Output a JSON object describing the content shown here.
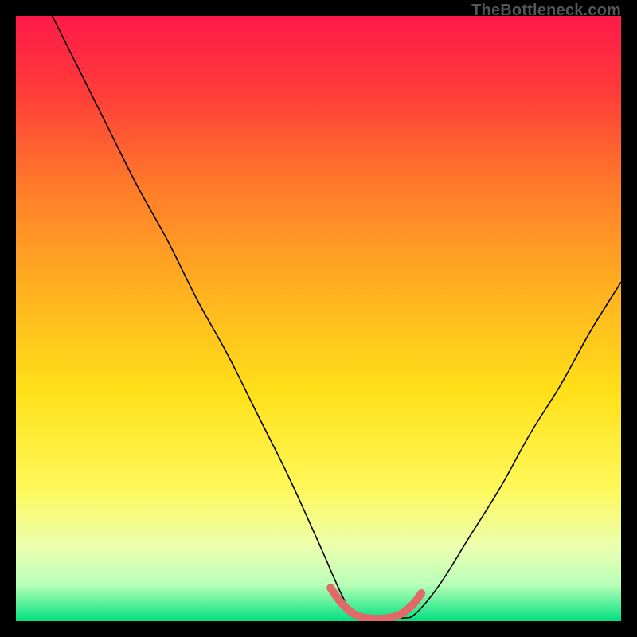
{
  "watermark": "TheBottleneck.com",
  "chart_data": {
    "type": "line",
    "title": "",
    "xlabel": "",
    "ylabel": "",
    "xlim": [
      0,
      100
    ],
    "ylim": [
      0,
      100
    ],
    "grid": false,
    "legend": false,
    "annotations": [],
    "background_gradient": {
      "orientation": "vertical",
      "stops": [
        {
          "pos": 0.0,
          "color": "#ff1a4a"
        },
        {
          "pos": 0.12,
          "color": "#ff3a3a"
        },
        {
          "pos": 0.28,
          "color": "#ff7a2a"
        },
        {
          "pos": 0.45,
          "color": "#ffb020"
        },
        {
          "pos": 0.62,
          "color": "#ffe018"
        },
        {
          "pos": 0.78,
          "color": "#fff85a"
        },
        {
          "pos": 0.88,
          "color": "#eaffb0"
        },
        {
          "pos": 0.94,
          "color": "#b8ffb8"
        },
        {
          "pos": 1.0,
          "color": "#00e080"
        }
      ]
    },
    "series": [
      {
        "name": "bottleneck-curve",
        "color": "#000000",
        "x": [
          6,
          10,
          15,
          20,
          25,
          30,
          35,
          40,
          45,
          50,
          54,
          56,
          58,
          60,
          62,
          64,
          66,
          70,
          75,
          80,
          85,
          90,
          95,
          100
        ],
        "y": [
          100,
          92,
          82,
          72,
          63,
          53,
          44,
          34,
          24,
          13,
          4,
          1,
          0.4,
          0.3,
          0.3,
          0.5,
          1.2,
          6,
          14,
          22,
          31,
          39,
          48,
          56
        ]
      },
      {
        "name": "optimal-band-marker",
        "color": "#e06a6a",
        "stroke_width": 10,
        "x": [
          52,
          53,
          54,
          55,
          56,
          57,
          58,
          59,
          60,
          61,
          62,
          63,
          64,
          65,
          66,
          67
        ],
        "y": [
          5.5,
          4.0,
          2.8,
          1.8,
          1.1,
          0.7,
          0.5,
          0.4,
          0.4,
          0.45,
          0.6,
          0.9,
          1.4,
          2.2,
          3.2,
          4.6
        ]
      }
    ],
    "optimal_range_x": [
      54,
      66
    ]
  }
}
